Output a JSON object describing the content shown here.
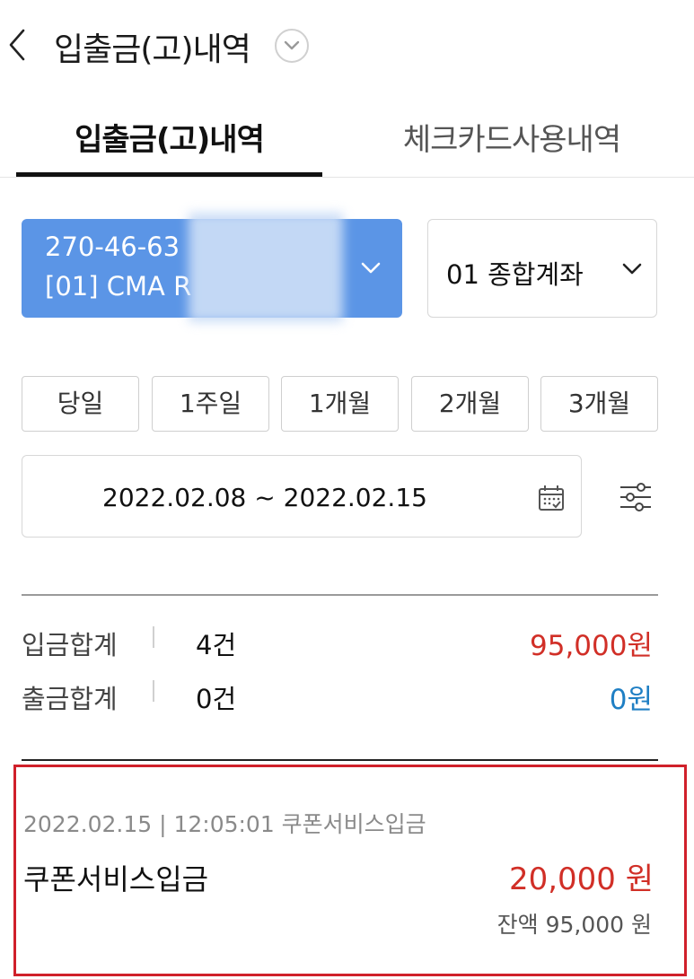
{
  "header": {
    "title": "입출금(고)내역"
  },
  "tabs": [
    {
      "label": "입출금(고)내역",
      "active": true
    },
    {
      "label": "체크카드사용내역",
      "active": false
    }
  ],
  "account": {
    "number": "270-46-63",
    "name": "[01] CMA R"
  },
  "account_type": {
    "label": "01 종합계좌"
  },
  "periods": [
    "당일",
    "1주일",
    "1개월",
    "2개월",
    "3개월"
  ],
  "date_range": "2022.02.08 ~ 2022.02.15",
  "summary": {
    "deposit": {
      "label": "입금합계",
      "count": "4건",
      "amount": "95,000원",
      "color": "#d12f27"
    },
    "withdraw": {
      "label": "출금합계",
      "count": "0건",
      "amount": "0원",
      "color": "#1f7fc4"
    }
  },
  "transaction": {
    "meta": "2022.02.15 | 12:05:01  쿠폰서비스입금",
    "name": "쿠폰서비스입금",
    "amount": "20,000 원",
    "balance": "잔액 95,000 원"
  },
  "colors": {
    "accent": "#5b95e6",
    "highlight_border": "#d0202a"
  }
}
